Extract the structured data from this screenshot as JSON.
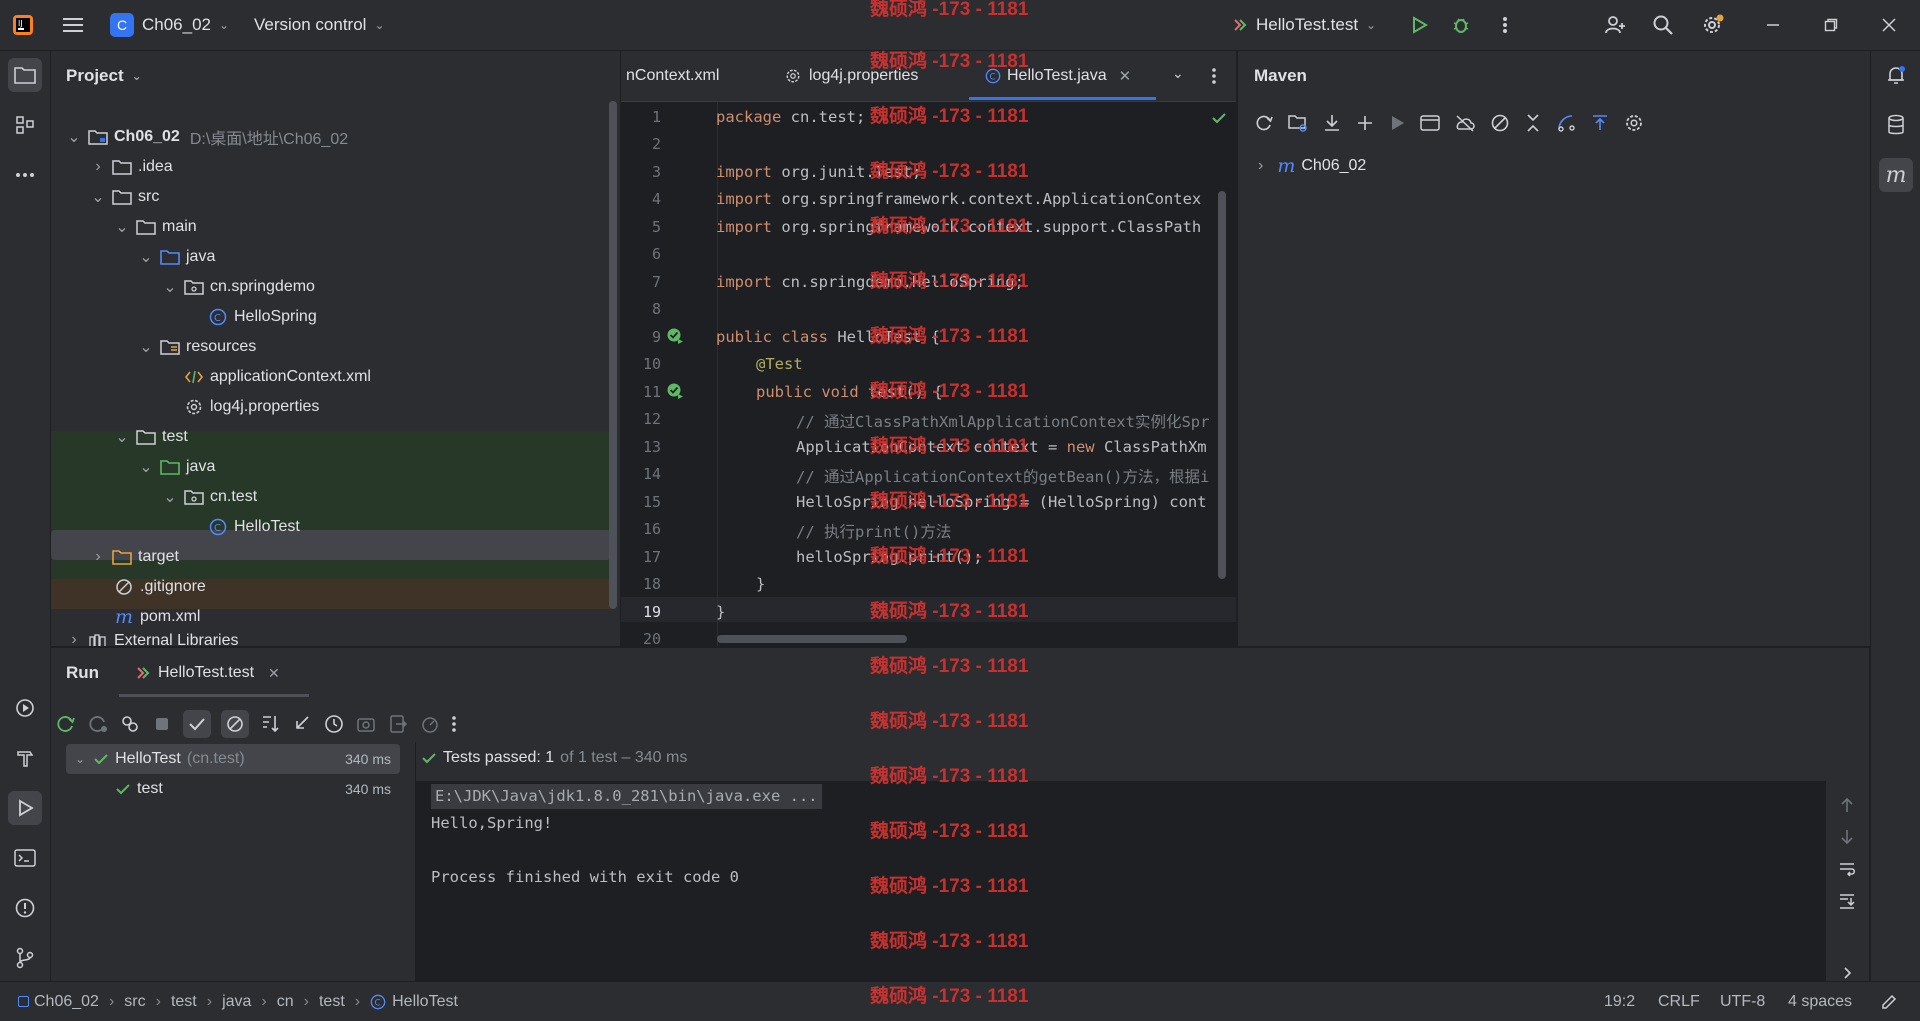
{
  "titlebar": {
    "project_badge": "C",
    "project_name": "Ch06_02",
    "vcs_label": "Version control",
    "run_config": "HelloTest.test"
  },
  "project_panel": {
    "title": "Project",
    "root_name": "Ch06_02",
    "root_path": "D:\\桌面\\地址\\Ch06_02",
    "items": [
      {
        "label": ".idea"
      },
      {
        "label": "src"
      },
      {
        "label": "main"
      },
      {
        "label": "java"
      },
      {
        "label": "cn.springdemo"
      },
      {
        "label": "HelloSpring"
      },
      {
        "label": "resources"
      },
      {
        "label": "applicationContext.xml"
      },
      {
        "label": "log4j.properties"
      },
      {
        "label": "test"
      },
      {
        "label": "java"
      },
      {
        "label": "cn.test"
      },
      {
        "label": "HelloTest"
      },
      {
        "label": "target"
      },
      {
        "label": ".gitignore"
      },
      {
        "label": "pom.xml"
      },
      {
        "label": "External Libraries"
      }
    ]
  },
  "editor": {
    "tabs": [
      {
        "label": "nContext.xml"
      },
      {
        "label": "log4j.properties"
      },
      {
        "label": "HelloTest.java"
      }
    ],
    "line_numbers": [
      "1",
      "2",
      "3",
      "4",
      "5",
      "6",
      "7",
      "8",
      "9",
      "10",
      "11",
      "12",
      "13",
      "14",
      "15",
      "16",
      "17",
      "18",
      "19",
      "20"
    ],
    "code": {
      "l1a": "package",
      "l1b": " cn.test;",
      "l3a": "import",
      "l3b": " org.junit.Test;",
      "l4a": "import",
      "l4b": " org.springframework.context.ApplicationContex",
      "l5a": "import",
      "l5b": " org.springframework.context.support.ClassPath",
      "l7a": "import",
      "l7b": " cn.springdemo.HelloSpring;",
      "l9a": "public class",
      "l9b": " HelloTest {",
      "l10": "@Test",
      "l11a": "public void",
      "l11b": " test() {",
      "l12": "// 通过ClassPathXmlApplicationContext实例化Spr",
      "l13a": "ApplicationContext context = ",
      "l13b": "new",
      "l13c": " ClassPathXm",
      "l14": "// 通过ApplicationContext的getBean()方法，根据i",
      "l15": "HelloSpring helloSpring = (HelloSpring) cont",
      "l16": "// 执行print()方法",
      "l17": "helloSpring.print();",
      "l18": "}",
      "l19": "}"
    }
  },
  "maven": {
    "title": "Maven",
    "root_item": "Ch06_02"
  },
  "run_panel": {
    "title": "Run",
    "config_tab": "HelloTest.test",
    "tests": [
      {
        "name": "HelloTest",
        "pkg": "(cn.test)",
        "time": "340 ms"
      },
      {
        "name": "test",
        "time": "340 ms"
      }
    ],
    "summary_passed": "Tests passed: 1",
    "summary_rest": "of 1 test – 340 ms",
    "console_lines": [
      "E:\\JDK\\Java\\jdk1.8.0_281\\bin\\java.exe ...",
      "Hello,Spring!",
      "",
      "Process finished with exit code 0"
    ]
  },
  "statusbar": {
    "breadcrumbs": [
      "Ch06_02",
      "src",
      "test",
      "java",
      "cn",
      "test",
      "HelloTest"
    ],
    "position": "19:2",
    "line_sep": "CRLF",
    "encoding": "UTF-8",
    "indent": "4 spaces"
  },
  "watermark": "魏硕鸿 -173 - 1181",
  "colors": {
    "accent": "#3574f0",
    "success": "#5fb865",
    "watermark": "#d9322f"
  }
}
